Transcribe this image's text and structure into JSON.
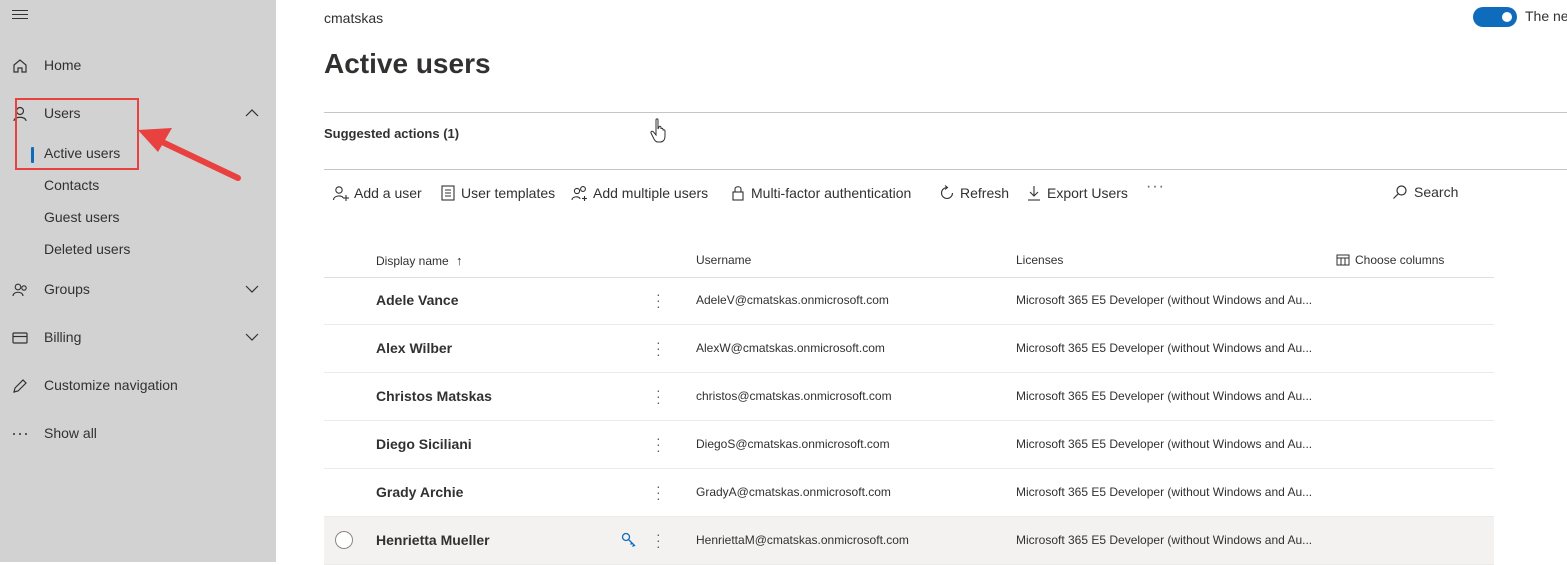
{
  "sidebar": {
    "items": [
      {
        "label": "Home",
        "icon": "home-icon"
      },
      {
        "label": "Users",
        "icon": "person-icon"
      },
      {
        "label": "Groups",
        "icon": "people-icon"
      },
      {
        "label": "Billing",
        "icon": "credit-card-icon"
      },
      {
        "label": "Customize navigation",
        "icon": "pencil-icon"
      },
      {
        "label": "Show all",
        "icon": "ellipsis-icon"
      }
    ],
    "users_subitems": [
      "Active users",
      "Contacts",
      "Guest users",
      "Deleted users"
    ],
    "active_item": "Active users"
  },
  "header": {
    "tenant": "cmatskas",
    "toggle_label": "The ne",
    "toggle_on": true
  },
  "page": {
    "title": "Active users",
    "suggested_actions": "Suggested actions (1)"
  },
  "toolbar": {
    "add_user": "Add a user",
    "user_templates": "User templates",
    "add_multiple": "Add multiple users",
    "mfa": "Multi-factor authentication",
    "refresh": "Refresh",
    "export": "Export Users",
    "more": "···",
    "search": "Search"
  },
  "table": {
    "columns": {
      "display_name": "Display name",
      "username": "Username",
      "licenses": "Licenses",
      "choose_columns": "Choose columns"
    },
    "sort_indicator": "↑",
    "rows": [
      {
        "name": "Adele Vance",
        "username": "AdeleV@cmatskas.onmicrosoft.com",
        "license": "Microsoft 365 E5 Developer (without Windows and Au..."
      },
      {
        "name": "Alex Wilber",
        "username": "AlexW@cmatskas.onmicrosoft.com",
        "license": "Microsoft 365 E5 Developer (without Windows and Au..."
      },
      {
        "name": "Christos Matskas",
        "username": "christos@cmatskas.onmicrosoft.com",
        "license": "Microsoft 365 E5 Developer (without Windows and Au..."
      },
      {
        "name": "Diego Siciliani",
        "username": "DiegoS@cmatskas.onmicrosoft.com",
        "license": "Microsoft 365 E5 Developer (without Windows and Au..."
      },
      {
        "name": "Grady Archie",
        "username": "GradyA@cmatskas.onmicrosoft.com",
        "license": "Microsoft 365 E5 Developer (without Windows and Au..."
      },
      {
        "name": "Henrietta Mueller",
        "username": "HenriettaM@cmatskas.onmicrosoft.com",
        "license": "Microsoft 365 E5 Developer (without Windows and Au..."
      }
    ]
  },
  "colors": {
    "sidebar_bg": "#d2d2d2",
    "accent": "#0f6cbd",
    "annotation": "#e8413f"
  }
}
